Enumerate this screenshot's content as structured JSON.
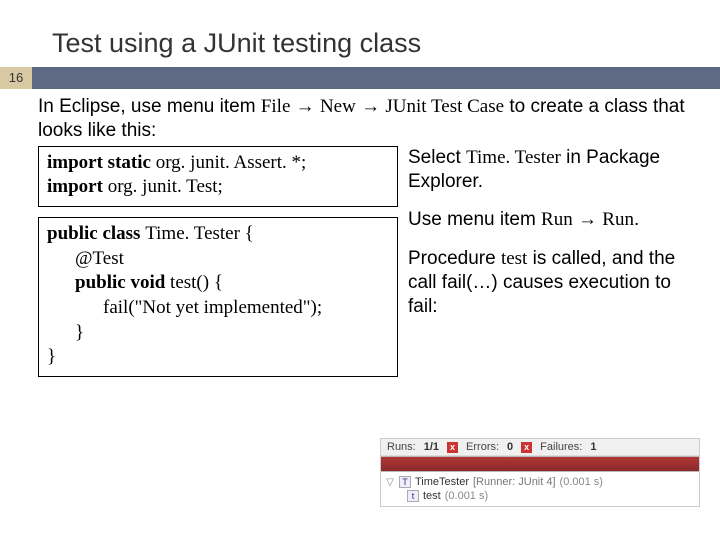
{
  "slide": {
    "title": "Test using a JUnit testing class",
    "number": "16"
  },
  "intro": {
    "prefix": "In Eclipse, use menu item ",
    "file": "File",
    "arrow1": " → ",
    "new": "New",
    "arrow2": " → ",
    "junit": "JUnit Test Case",
    "suffix": " to create a class that looks like this:"
  },
  "code": {
    "l1a": "import static",
    "l1b": " org. junit. Assert. *;",
    "l2a": "import",
    "l2b": " org. junit. Test;",
    "l3a": "public class ",
    "l3b": "Time. Tester {",
    "l4": "@Test",
    "l5a": "public void",
    "l5b": " test() {",
    "l6": "fail(\"Not yet implemented\");",
    "l7": "}",
    "l8": "}"
  },
  "right": {
    "p1a": "Select ",
    "p1b": "Time. Tester",
    "p1c": " in Package Explorer.",
    "p2a": "Use menu item ",
    "p2b": "Run",
    "p2arr": " → ",
    "p2c": "Run",
    "p2d": ".",
    "p3a": "Procedure ",
    "p3b": "test",
    "p3c": " is called, and the call fail(…) causes execution to fail:"
  },
  "junit": {
    "runs_label": "Runs:",
    "runs_value": "1/1",
    "errors_label": "Errors:",
    "errors_value": "0",
    "failures_label": "Failures:",
    "failures_value": "1",
    "tree_root": "TimeTester",
    "tree_root_runner": " [Runner: JUnit 4]",
    "tree_root_time": " (0.001 s)",
    "tree_leaf": "test",
    "tree_leaf_time": " (0.001 s)"
  }
}
